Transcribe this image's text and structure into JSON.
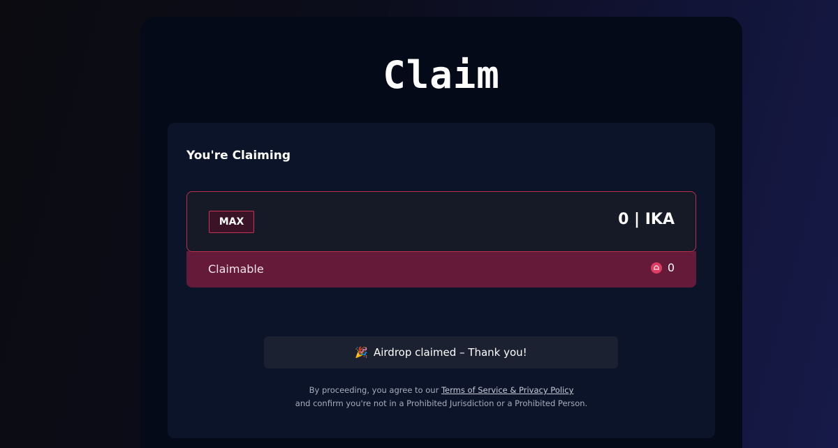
{
  "page": {
    "title": "Claim"
  },
  "card": {
    "heading": "You're Claiming",
    "max_label": "MAX",
    "amount": "0 | IKA",
    "claimable_label": "Claimable",
    "claimable_value": "0",
    "claimable_icon": "ika-token-icon"
  },
  "status": {
    "icon": "party-popper-icon",
    "label": "Airdrop claimed – Thank you!"
  },
  "legal": {
    "prefix": "By proceeding, you agree to our ",
    "link": "Terms of Service & Privacy Policy",
    "line2": "and confirm you're not in a Prohibited Jurisdiction or a Prohibited Person."
  },
  "colors": {
    "accent": "#c83356",
    "claimable_bg": "#661a39",
    "panel_bg": "#050a18",
    "card_bg": "#0c1429"
  }
}
